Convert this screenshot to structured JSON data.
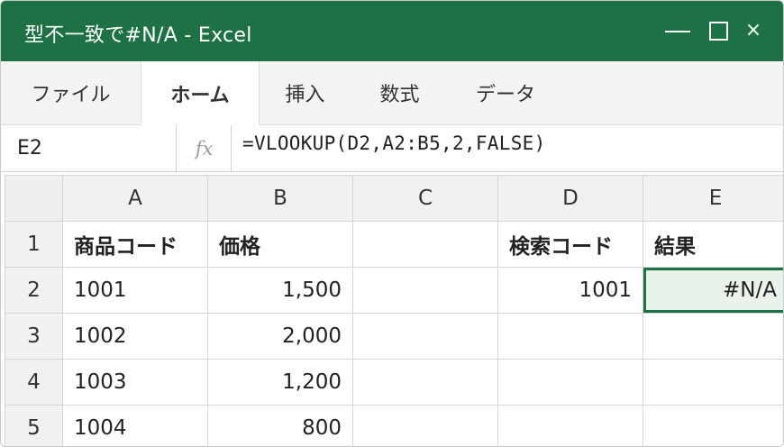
{
  "window": {
    "title": "型不一致で#N/A - Excel",
    "controls": {
      "minimize": "—",
      "close": "×"
    }
  },
  "ribbon": {
    "tabs": [
      {
        "label": "ファイル",
        "active": false
      },
      {
        "label": "ホーム",
        "active": true
      },
      {
        "label": "挿入",
        "active": false
      },
      {
        "label": "数式",
        "active": false
      },
      {
        "label": "データ",
        "active": false
      }
    ]
  },
  "formula_bar": {
    "name_box": "E2",
    "fx_label": "fx",
    "formula": "=VLOOKUP(D2,A2:B5,2,FALSE)"
  },
  "sheet": {
    "columns": [
      "A",
      "B",
      "C",
      "D",
      "E"
    ],
    "rows": [
      {
        "num": "1",
        "A": "商品コード",
        "B": "価格",
        "C": "",
        "D": "検索コード",
        "E": "結果"
      },
      {
        "num": "2",
        "A": "1001",
        "B": "1,500",
        "C": "",
        "D": "1001",
        "E": "#N/A"
      },
      {
        "num": "3",
        "A": "1002",
        "B": "2,000",
        "C": "",
        "D": "",
        "E": ""
      },
      {
        "num": "4",
        "A": "1003",
        "B": "1,200",
        "C": "",
        "D": "",
        "E": ""
      },
      {
        "num": "5",
        "A": "1004",
        "B": "800",
        "C": "",
        "D": "",
        "E": ""
      }
    ],
    "selected_cell": "E2",
    "accent_color": "#1e7145"
  }
}
